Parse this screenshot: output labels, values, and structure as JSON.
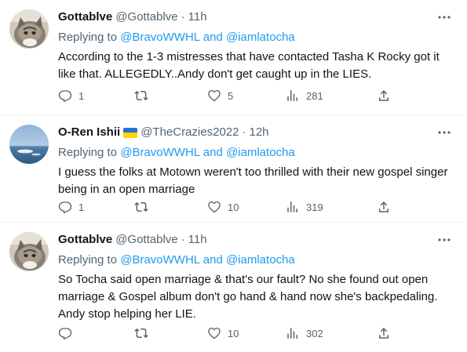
{
  "tweets": [
    {
      "display_name": "Gottablve",
      "handle": "@Gottablve",
      "dot": "·",
      "time": "11h",
      "replying_prefix": "Replying to",
      "mention_1": "@BravoWWHL",
      "and": "and",
      "mention_2": "@iamlatocha",
      "text": "According to the 1-3 mistresses that have contacted Tasha K Rocky got it like that. ALLEGEDLY..Andy don't get caught up in the LIES.",
      "replies": "1",
      "retweets": "",
      "likes": "5",
      "views": "281",
      "avatar": "cat-photo",
      "flag": null
    },
    {
      "display_name": "O-Ren Ishii",
      "handle": "@TheCrazies2022",
      "dot": "·",
      "time": "12h",
      "replying_prefix": "Replying to",
      "mention_1": "@BravoWWHL",
      "and": "and",
      "mention_2": "@iamlatocha",
      "text": "I guess the folks at Motown weren't too thrilled with their new gospel singer being in an open marriage",
      "replies": "1",
      "retweets": "",
      "likes": "10",
      "views": "319",
      "avatar": "ocean-photo",
      "flag": "ukraine-flag"
    },
    {
      "display_name": "Gottablve",
      "handle": "@Gottablve",
      "dot": "·",
      "time": "11h",
      "replying_prefix": "Replying to",
      "mention_1": "@BravoWWHL",
      "and": "and",
      "mention_2": "@iamlatocha",
      "text": "So Tocha said open marriage & that's our fault? No she found out open marriage & Gospel album don't go hand & hand now she's backpedaling. Andy stop helping her LIE.",
      "replies": "",
      "retweets": "",
      "likes": "10",
      "views": "302",
      "avatar": "cat-photo",
      "flag": null
    }
  ],
  "colors": {
    "text": "#0f1419",
    "secondary": "#536471",
    "link": "#1d9bf0",
    "divider": "#eff3f4"
  }
}
